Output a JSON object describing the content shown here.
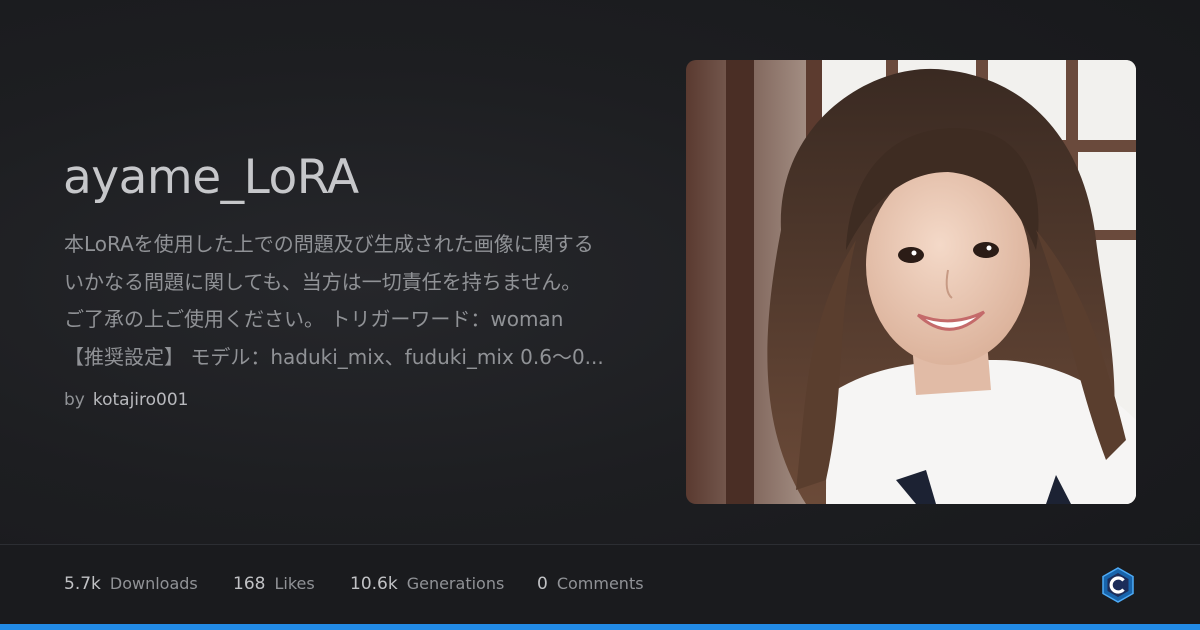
{
  "model": {
    "title": "ayame_LoRA",
    "description_lines": [
      "本LoRAを使用した上での問題及び生成された画像に関する",
      "いかなる問題に関しても、当方は一切責任を持ちません。",
      "ご了承の上ご使用ください。 トリガーワード：woman",
      "【推奨設定】 モデル：haduki_mix、fuduki_mix 0.6～0..."
    ],
    "author_prefix": "by",
    "author": "kotajiro001"
  },
  "stats": [
    {
      "value": "5.7k",
      "label": "Downloads"
    },
    {
      "value": "168",
      "label": "Likes"
    },
    {
      "value": "10.6k",
      "label": "Generations"
    },
    {
      "value": "0",
      "label": "Comments"
    }
  ],
  "hero_image": {
    "icon": "portrait-photo"
  },
  "brand": {
    "icon": "civitai-logo-icon",
    "accent": "#228be6",
    "logo_color": "#1864ab"
  }
}
